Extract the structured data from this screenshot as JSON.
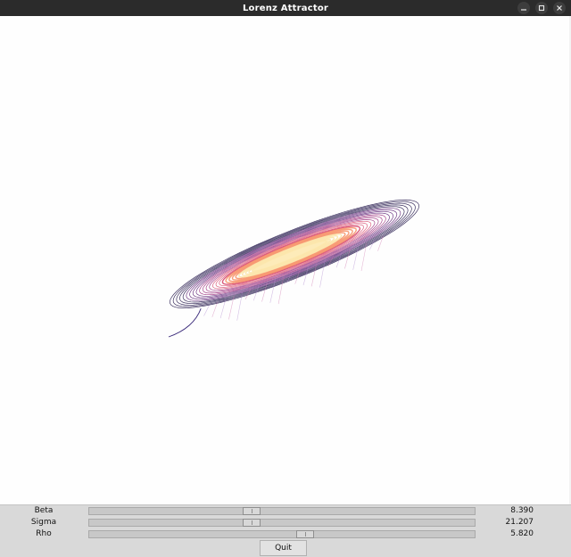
{
  "window": {
    "title": "Lorenz Attractor"
  },
  "icons": {
    "minimize": "minimize-icon",
    "maximize": "maximize-icon",
    "close": "close-icon"
  },
  "plot": {
    "description_color_palette": [
      "#1d1147",
      "#5b1d73",
      "#9a2b7b",
      "#d84a6e",
      "#f7956b",
      "#fce4a8"
    ]
  },
  "controls": {
    "beta": {
      "label": "Beta",
      "value": "8.390",
      "position": 0.415
    },
    "sigma": {
      "label": "Sigma",
      "value": "21.207",
      "position": 0.415
    },
    "rho": {
      "label": "Rho",
      "value": "5.820",
      "position": 0.56
    },
    "quit_label": "Quit"
  }
}
